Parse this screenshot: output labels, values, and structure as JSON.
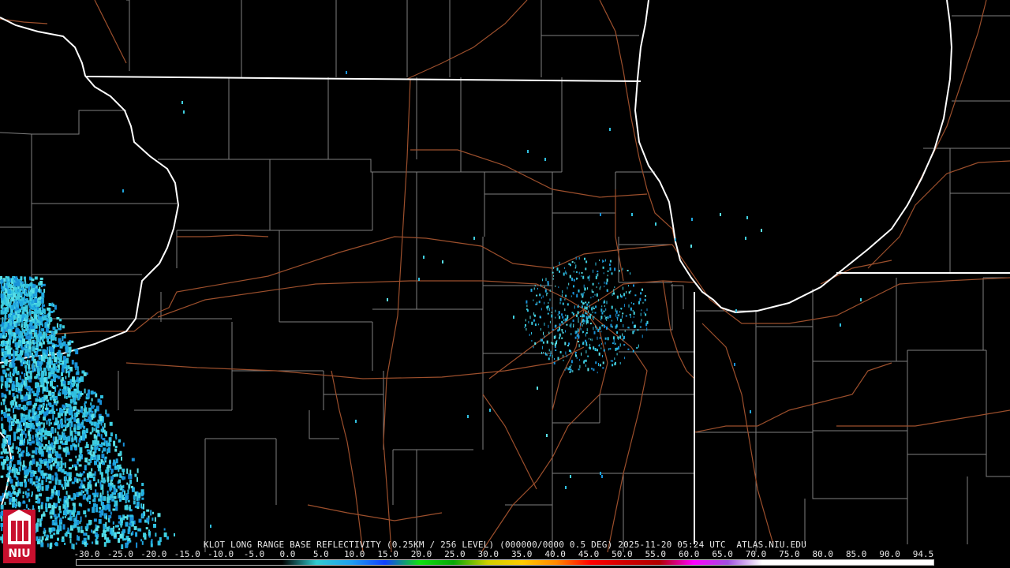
{
  "radar_title": "KLOT LONG RANGE BASE REFLECTIVITY (0.25KM / 256 LEVEL) (000000/0000 0.5 DEG) 2025-11-20 05:24 UTC  ATLAS.NIU.EDU",
  "logo_text": "NIU",
  "color_scale": {
    "labels": [
      "-30.0",
      "-25.0",
      "-20.0",
      "-15.0",
      "-10.0",
      "-5.0",
      "0.0",
      "5.0",
      "10.0",
      "15.0",
      "20.0",
      "25.0",
      "30.0",
      "35.0",
      "40.0",
      "45.0",
      "50.0",
      "55.0",
      "60.0",
      "65.0",
      "70.0",
      "75.0",
      "80.0",
      "85.0",
      "90.0",
      "94.5"
    ],
    "gradient_stops": [
      "#000000",
      "#000000",
      "#000000",
      "#000000",
      "#000000",
      "#000000",
      "#000000",
      "#30ccd0",
      "#20a0f0",
      "#1040ff",
      "#10e010",
      "#08a808",
      "#d0d000",
      "#ffcc00",
      "#ff8800",
      "#ff0000",
      "#d00000",
      "#b00000",
      "#ff00ff",
      "#a050e0",
      "#ffffff",
      "#ffffff",
      "#ffffff",
      "#ffffff",
      "#ffffff",
      "#ffffff"
    ]
  },
  "colors": {
    "background": "#000000",
    "state_border": "#ffffff",
    "county_border": "#808080",
    "roads": "#a0522d",
    "echo_light": "#40d0e0",
    "echo_mid": "#20a8e0",
    "logo_red": "#c8102e"
  }
}
